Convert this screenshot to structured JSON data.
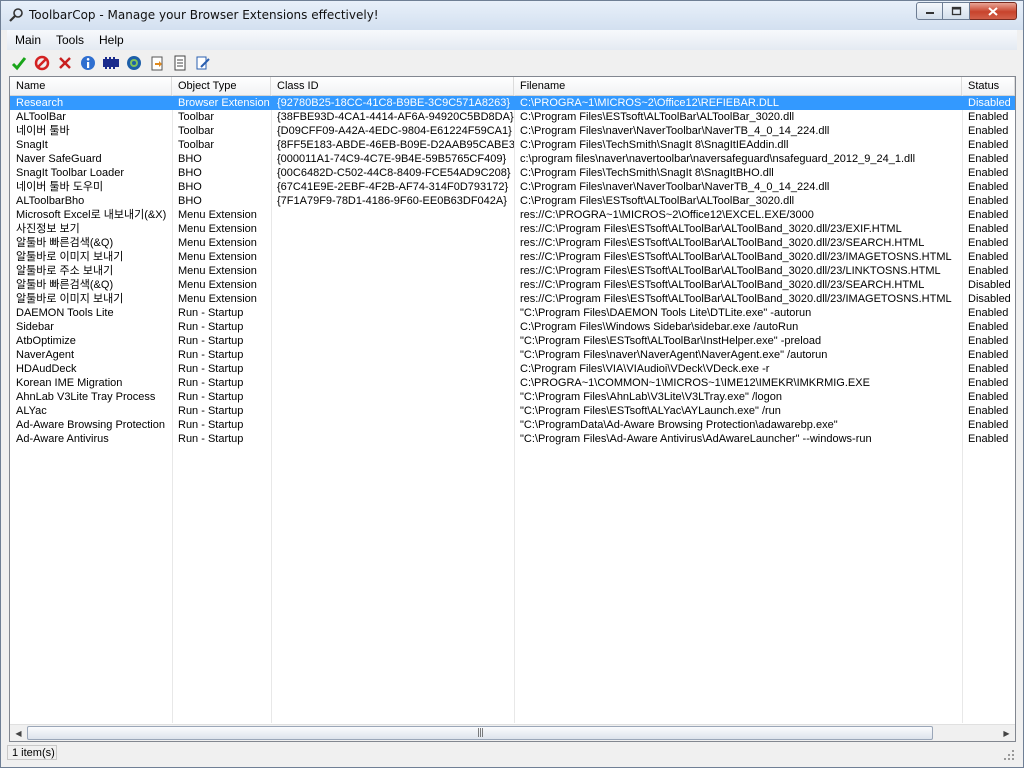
{
  "window": {
    "title": "ToolbarCop - Manage your Browser Extensions effectively!"
  },
  "menu": [
    "Main",
    "Tools",
    "Help"
  ],
  "toolbar_icons": [
    "enable-icon",
    "disable-icon",
    "delete-icon",
    "info-icon",
    "settings-icon",
    "refresh-icon",
    "export-icon",
    "report-icon",
    "edit-icon"
  ],
  "columns": [
    "Name",
    "Object Type",
    "Class ID",
    "Filename",
    "Status"
  ],
  "rows": [
    {
      "name": "Research",
      "type": "Browser Extension",
      "clsid": "{92780B25-18CC-41C8-B9BE-3C9C571A8263}",
      "file": "C:\\PROGRA~1\\MICROS~2\\Office12\\REFIEBAR.DLL",
      "status": "Disabled",
      "selected": true
    },
    {
      "name": "ALToolBar",
      "type": "Toolbar",
      "clsid": "{38FBE93D-4CA1-4414-AF6A-94920C5BD8DA}",
      "file": "C:\\Program Files\\ESTsoft\\ALToolBar\\ALToolBar_3020.dll",
      "status": "Enabled"
    },
    {
      "name": "네이버 툴바",
      "type": "Toolbar",
      "clsid": "{D09CFF09-A42A-4EDC-9804-E61224F59CA1}",
      "file": "C:\\Program Files\\naver\\NaverToolbar\\NaverTB_4_0_14_224.dll",
      "status": "Enabled"
    },
    {
      "name": "SnagIt",
      "type": "Toolbar",
      "clsid": "{8FF5E183-ABDE-46EB-B09E-D2AAB95CABE3}",
      "file": "C:\\Program Files\\TechSmith\\SnagIt 8\\SnagItIEAddin.dll",
      "status": "Enabled"
    },
    {
      "name": "Naver SafeGuard",
      "type": "BHO",
      "clsid": "{000011A1-74C9-4C7E-9B4E-59B5765CF409}",
      "file": "c:\\program files\\naver\\navertoolbar\\naversafeguard\\nsafeguard_2012_9_24_1.dll",
      "status": "Enabled"
    },
    {
      "name": "SnagIt Toolbar Loader",
      "type": "BHO",
      "clsid": "{00C6482D-C502-44C8-8409-FCE54AD9C208}",
      "file": "C:\\Program Files\\TechSmith\\SnagIt 8\\SnagItBHO.dll",
      "status": "Enabled"
    },
    {
      "name": "네이버 툴바 도우미",
      "type": "BHO",
      "clsid": "{67C41E9E-2EBF-4F2B-AF74-314F0D793172}",
      "file": "C:\\Program Files\\naver\\NaverToolbar\\NaverTB_4_0_14_224.dll",
      "status": "Enabled"
    },
    {
      "name": "ALToolbarBho",
      "type": "BHO",
      "clsid": "{7F1A79F9-78D1-4186-9F60-EE0B63DF042A}",
      "file": "C:\\Program Files\\ESTsoft\\ALToolBar\\ALToolBar_3020.dll",
      "status": "Enabled"
    },
    {
      "name": "Microsoft Excel로 내보내기(&X)",
      "type": "Menu Extension",
      "clsid": "",
      "file": "res://C:\\PROGRA~1\\MICROS~2\\Office12\\EXCEL.EXE/3000",
      "status": "Enabled"
    },
    {
      "name": "사진정보 보기",
      "type": "Menu Extension",
      "clsid": "",
      "file": "res://C:\\Program Files\\ESTsoft\\ALToolBar\\ALToolBand_3020.dll/23/EXIF.HTML",
      "status": "Enabled"
    },
    {
      "name": "알툴바 빠른검색(&Q)",
      "type": "Menu Extension",
      "clsid": "",
      "file": "res://C:\\Program Files\\ESTsoft\\ALToolBar\\ALToolBand_3020.dll/23/SEARCH.HTML",
      "status": "Enabled"
    },
    {
      "name": "알툴바로 이미지 보내기",
      "type": "Menu Extension",
      "clsid": "",
      "file": "res://C:\\Program Files\\ESTsoft\\ALToolBar\\ALToolBand_3020.dll/23/IMAGETOSNS.HTML",
      "status": "Enabled"
    },
    {
      "name": "알툴바로 주소 보내기",
      "type": "Menu Extension",
      "clsid": "",
      "file": "res://C:\\Program Files\\ESTsoft\\ALToolBar\\ALToolBand_3020.dll/23/LINKTOSNS.HTML",
      "status": "Enabled"
    },
    {
      "name": "알툴바 빠른검색(&Q)",
      "type": "Menu Extension",
      "clsid": "",
      "file": "res://C:\\Program Files\\ESTsoft\\ALToolBar\\ALToolBand_3020.dll/23/SEARCH.HTML",
      "status": "Disabled"
    },
    {
      "name": "알툴바로 이미지 보내기",
      "type": "Menu Extension",
      "clsid": "",
      "file": "res://C:\\Program Files\\ESTsoft\\ALToolBar\\ALToolBand_3020.dll/23/IMAGETOSNS.HTML",
      "status": "Disabled"
    },
    {
      "name": "DAEMON Tools Lite",
      "type": "Run - Startup",
      "clsid": "",
      "file": "\"C:\\Program Files\\DAEMON Tools Lite\\DTLite.exe\" -autorun",
      "status": "Enabled"
    },
    {
      "name": "Sidebar",
      "type": "Run - Startup",
      "clsid": "",
      "file": "C:\\Program Files\\Windows Sidebar\\sidebar.exe /autoRun",
      "status": "Enabled"
    },
    {
      "name": "AtbOptimize",
      "type": "Run - Startup",
      "clsid": "",
      "file": "\"C:\\Program Files\\ESTsoft\\ALToolBar\\InstHelper.exe\" -preload",
      "status": "Enabled"
    },
    {
      "name": "NaverAgent",
      "type": "Run - Startup",
      "clsid": "",
      "file": "\"C:\\Program Files\\naver\\NaverAgent\\NaverAgent.exe\" /autorun",
      "status": "Enabled"
    },
    {
      "name": "HDAudDeck",
      "type": "Run - Startup",
      "clsid": "",
      "file": "C:\\Program Files\\VIA\\VIAudioi\\VDeck\\VDeck.exe -r",
      "status": "Enabled"
    },
    {
      "name": "Korean IME Migration",
      "type": "Run - Startup",
      "clsid": "",
      "file": "C:\\PROGRA~1\\COMMON~1\\MICROS~1\\IME12\\IMEKR\\IMKRMIG.EXE",
      "status": "Enabled"
    },
    {
      "name": "AhnLab V3Lite Tray Process",
      "type": "Run - Startup",
      "clsid": "",
      "file": "\"C:\\Program Files\\AhnLab\\V3Lite\\V3LTray.exe\" /logon",
      "status": "Enabled"
    },
    {
      "name": "ALYac",
      "type": "Run - Startup",
      "clsid": "",
      "file": "\"C:\\Program Files\\ESTsoft\\ALYac\\AYLaunch.exe\" /run",
      "status": "Enabled"
    },
    {
      "name": "Ad-Aware Browsing Protection",
      "type": "Run - Startup",
      "clsid": "",
      "file": "\"C:\\ProgramData\\Ad-Aware Browsing Protection\\adawarebp.exe\"",
      "status": "Enabled"
    },
    {
      "name": "Ad-Aware Antivirus",
      "type": "Run - Startup",
      "clsid": "",
      "file": "\"C:\\Program Files\\Ad-Aware Antivirus\\AdAwareLauncher\" --windows-run",
      "status": "Enabled"
    }
  ],
  "status_bar": {
    "text": "1 item(s)"
  },
  "colors": {
    "selection": "#3399ff",
    "close_button": "#c8432c"
  }
}
